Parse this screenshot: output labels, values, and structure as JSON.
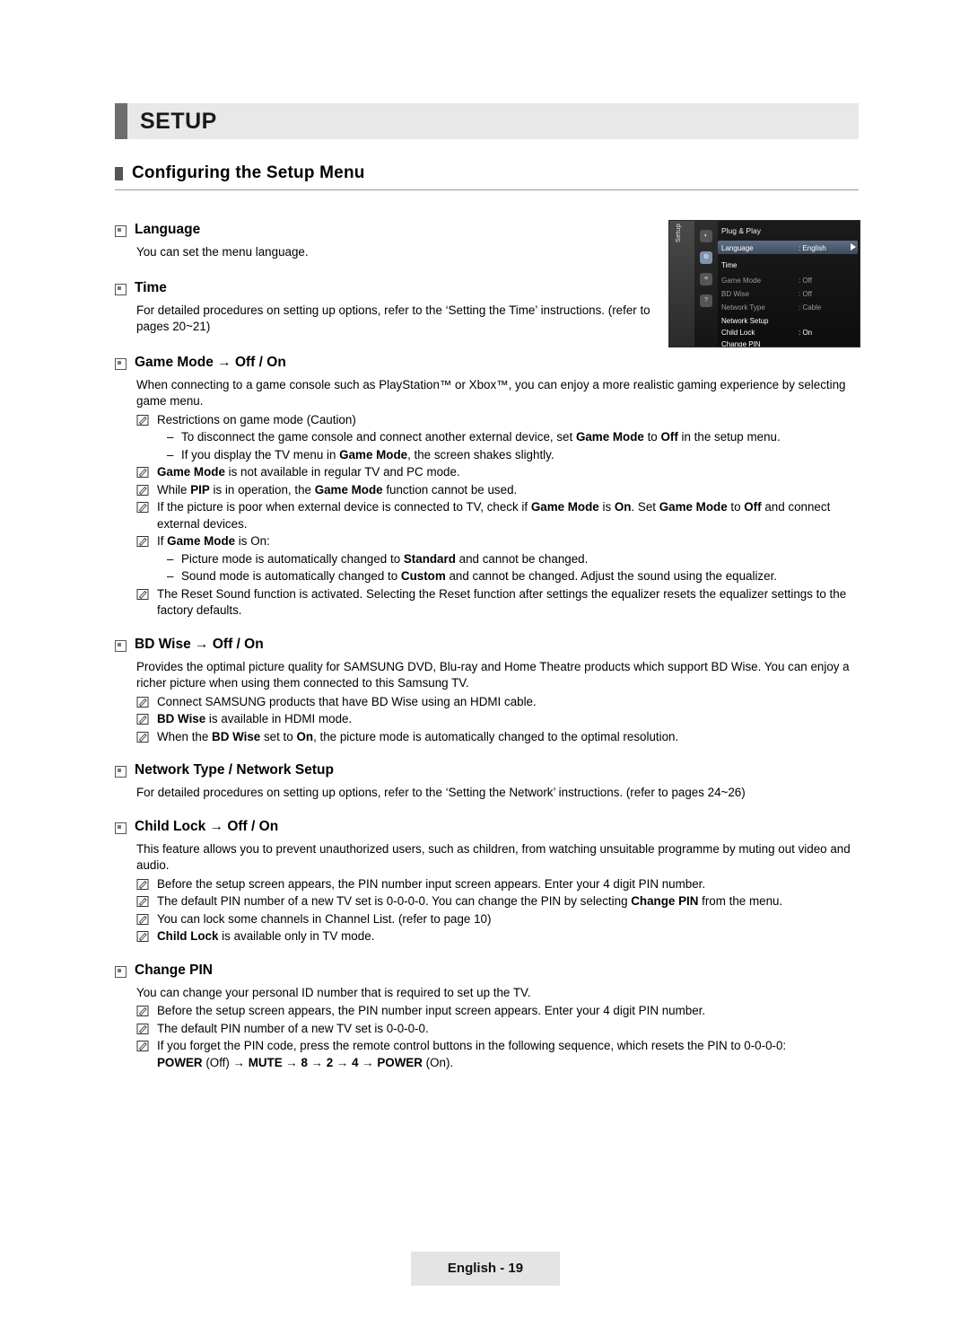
{
  "banner": {
    "title": "SETUP"
  },
  "section": {
    "title": "Configuring the Setup Menu"
  },
  "entries": [
    {
      "heading": "Language",
      "paras": [
        "You can set the menu language."
      ]
    },
    {
      "heading": "Time",
      "paras": [
        "For detailed procedures on setting up options, refer to the ‘Setting the Time’ instructions. (refer to pages 20~21)"
      ]
    },
    {
      "heading": "Game Mode → Off / On",
      "paras": [
        "When connecting to a game console such as PlayStation™ or Xbox™, you can enjoy a more realistic gaming experience by selecting game menu."
      ],
      "notes": [
        "Restrictions on game mode (Caution)",
        "Game Mode is not available in regular TV and PC mode.",
        "While PIP is in operation, the Game Mode function cannot be used.",
        "If the picture is poor when external device is connected to TV, check if Game Mode is On. Set Game Mode to Off and connect external devices.",
        "If Game Mode is On:",
        "The Reset Sound function is activated. Selecting the Reset function after settings the equalizer resets the equalizer settings to the factory defaults."
      ],
      "dashes": [
        "To disconnect the game console and connect another external device, set Game Mode to Off in the setup menu.",
        "If you display the TV menu in Game Mode, the screen shakes slightly.",
        "Picture mode is automatically changed to Standard and cannot be changed.",
        "Sound mode is automatically changed to Custom and cannot be changed. Adjust the sound using the equalizer."
      ]
    },
    {
      "heading": "BD Wise → Off / On",
      "paras": [
        "Provides the optimal picture quality for SAMSUNG DVD, Blu-ray and Home Theatre products which support BD Wise. You can enjoy a richer picture when using them connected to this Samsung TV."
      ],
      "notes": [
        "Connect SAMSUNG products that have BD Wise using an HDMI cable.",
        "BD Wise is available in HDMI mode.",
        "When the BD Wise set to On, the picture mode is automatically changed to the optimal resolution."
      ]
    },
    {
      "heading": "Network Type / Network Setup",
      "paras": [
        "For detailed procedures on setting up options, refer to the ‘Setting the Network’ instructions. (refer to pages 24~26)"
      ]
    },
    {
      "heading": "Child Lock → Off / On",
      "paras": [
        "This feature allows you to prevent unauthorized users, such as children, from watching unsuitable programme by muting out video and audio."
      ],
      "notes": [
        "Before the setup screen appears, the PIN number input screen appears. Enter your 4 digit PIN number.",
        "The default PIN number of a new TV set is 0-0-0-0. You can change the PIN by selecting Change PIN from the menu.",
        "You can lock some channels in Channel List. (refer to page 10)",
        "Child Lock is available only in TV mode."
      ]
    },
    {
      "heading": "Change PIN",
      "paras": [
        "You can change your personal ID number that is required to set up the TV."
      ],
      "notes": [
        "Before the setup screen appears, the PIN number input screen appears. Enter your 4 digit PIN number.",
        "The default PIN number of a new TV set is 0-0-0-0.",
        "If you forget the PIN code, press the remote control buttons in the following sequence, which resets the PIN to 0-0-0-0: POWER (Off) → MUTE → 8 → 2 → 4 → POWER (On)."
      ]
    }
  ],
  "osd": {
    "tab_label": "Setup",
    "title": "Plug & Play",
    "rows": [
      {
        "label": "Language",
        "value": ": English"
      },
      {
        "label": "Time",
        "value": ""
      },
      {
        "label": "Game Mode",
        "value": ": Off"
      },
      {
        "label": "BD Wise",
        "value": ": Off"
      },
      {
        "label": "Network Type",
        "value": ": Cable"
      },
      {
        "label": "Network Setup",
        "value": ""
      },
      {
        "label": "Child Lock",
        "value": ": On"
      },
      {
        "label": "Change PIN",
        "value": ""
      }
    ]
  },
  "footer": {
    "page_label": "English - 19"
  }
}
